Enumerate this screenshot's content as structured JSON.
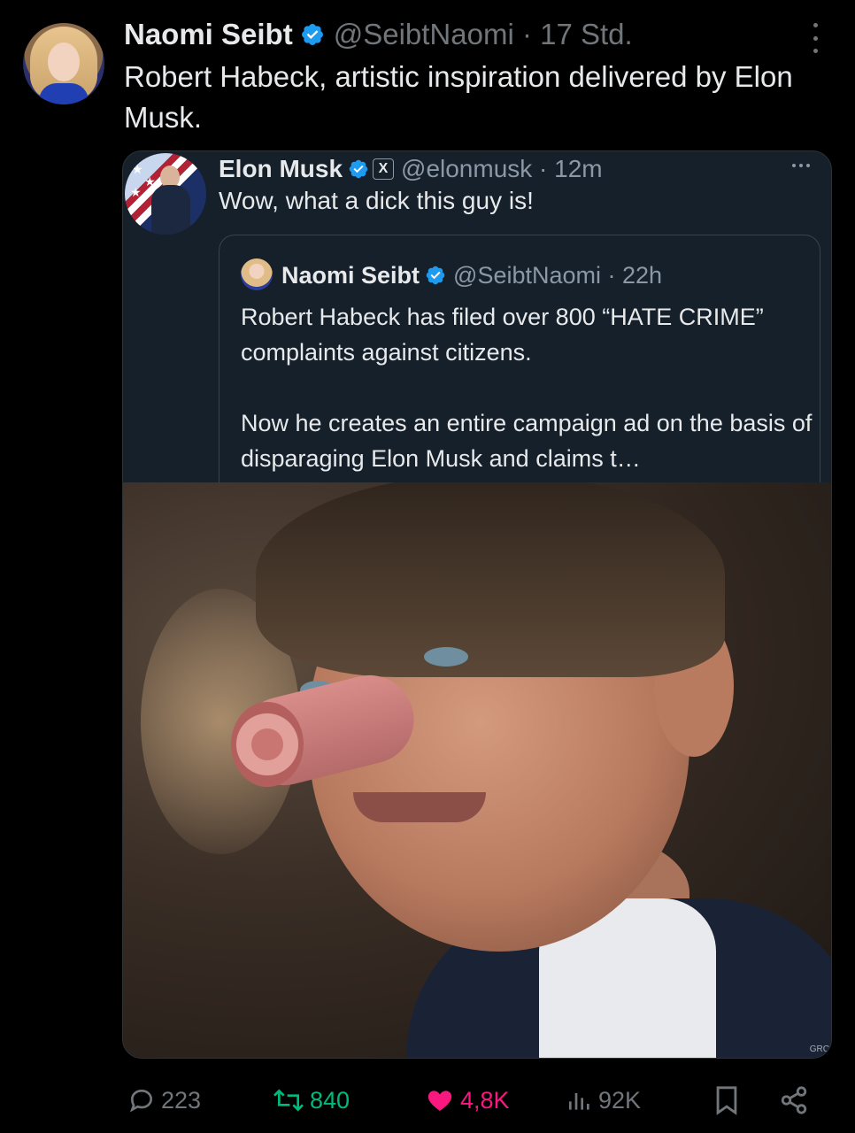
{
  "tweet": {
    "author_name": "Naomi Seibt",
    "author_handle": "@SeibtNaomi · 17 Std.",
    "text": "Robert Habeck, artistic inspiration delivered by Elon Musk."
  },
  "quoted": {
    "author_name": "Elon Musk",
    "author_handle": "@elonmusk · 12m",
    "text": "Wow, what a dick this guy is!",
    "x_badge": "X"
  },
  "inner_quote": {
    "author_name": "Naomi Seibt",
    "author_handle": "@SeibtNaomi · 22h",
    "paragraph1": "Robert Habeck has filed over 800 “HATE CRIME” complaints against citizens.",
    "paragraph2": "Now he creates an entire campaign ad on the basis of disparaging Elon Musk and claims t…"
  },
  "media": {
    "watermark": "GRC"
  },
  "actions": {
    "replies": "223",
    "reposts": "840",
    "likes": "4,8K",
    "views": "92K"
  },
  "colors": {
    "background": "#000000",
    "quote_background": "#15202b",
    "verified": "#1d9bf0",
    "repost": "#00ba7c",
    "like": "#f91880",
    "muted": "#71767b"
  }
}
